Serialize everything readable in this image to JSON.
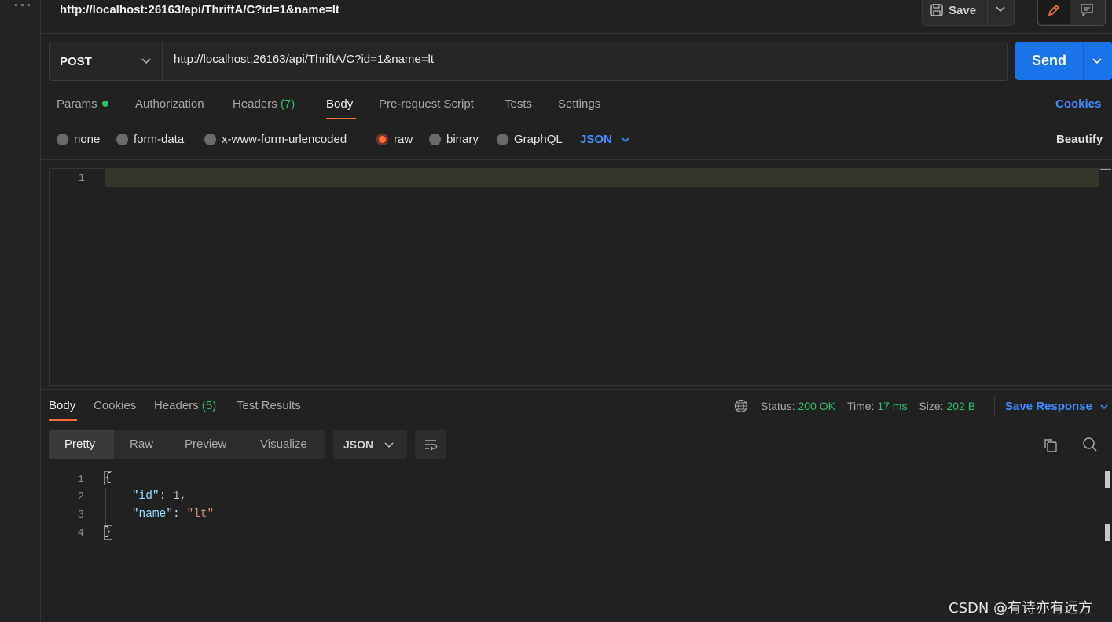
{
  "window": {
    "title": "http://localhost:26163/api/ThriftA/C?id=1&name=lt",
    "save_label": "Save"
  },
  "request": {
    "method": "POST",
    "url": "http://localhost:26163/api/ThriftA/C?id=1&name=lt",
    "send_label": "Send",
    "tabs": [
      {
        "label": "Params"
      },
      {
        "label": "Authorization"
      },
      {
        "label": "Headers",
        "count": "(7)"
      },
      {
        "label": "Body"
      },
      {
        "label": "Pre-request Script"
      },
      {
        "label": "Tests"
      },
      {
        "label": "Settings"
      }
    ],
    "active_tab": "Body",
    "cookies_label": "Cookies",
    "body_types": [
      "none",
      "form-data",
      "x-www-form-urlencoded",
      "raw",
      "binary",
      "GraphQL"
    ],
    "selected_body_type": "raw",
    "raw_format": "JSON",
    "beautify_label": "Beautify",
    "editor_lines": [
      "1"
    ]
  },
  "response": {
    "tabs": [
      {
        "label": "Body"
      },
      {
        "label": "Cookies"
      },
      {
        "label": "Headers",
        "count": "(5)"
      },
      {
        "label": "Test Results"
      }
    ],
    "status_label": "Status:",
    "status_value": "200 OK",
    "time_label": "Time:",
    "time_value": "17 ms",
    "size_label": "Size:",
    "size_value": "202 B",
    "save_response_label": "Save Response",
    "view_modes": [
      "Pretty",
      "Raw",
      "Preview",
      "Visualize"
    ],
    "active_view": "Pretty",
    "format": "JSON",
    "line_numbers": [
      "1",
      "2",
      "3",
      "4"
    ],
    "body": {
      "open": "{",
      "key_id": "\"id\"",
      "value_id": "1",
      "key_name": "\"name\"",
      "value_name": "\"lt\"",
      "close": "}"
    }
  },
  "watermark": "CSDN @有诗亦有远方",
  "colors": {
    "accent_orange": "#ff6c37",
    "send_blue": "#1a73e8",
    "link_blue": "#3f8fff",
    "status_green": "#2fbf6b"
  }
}
